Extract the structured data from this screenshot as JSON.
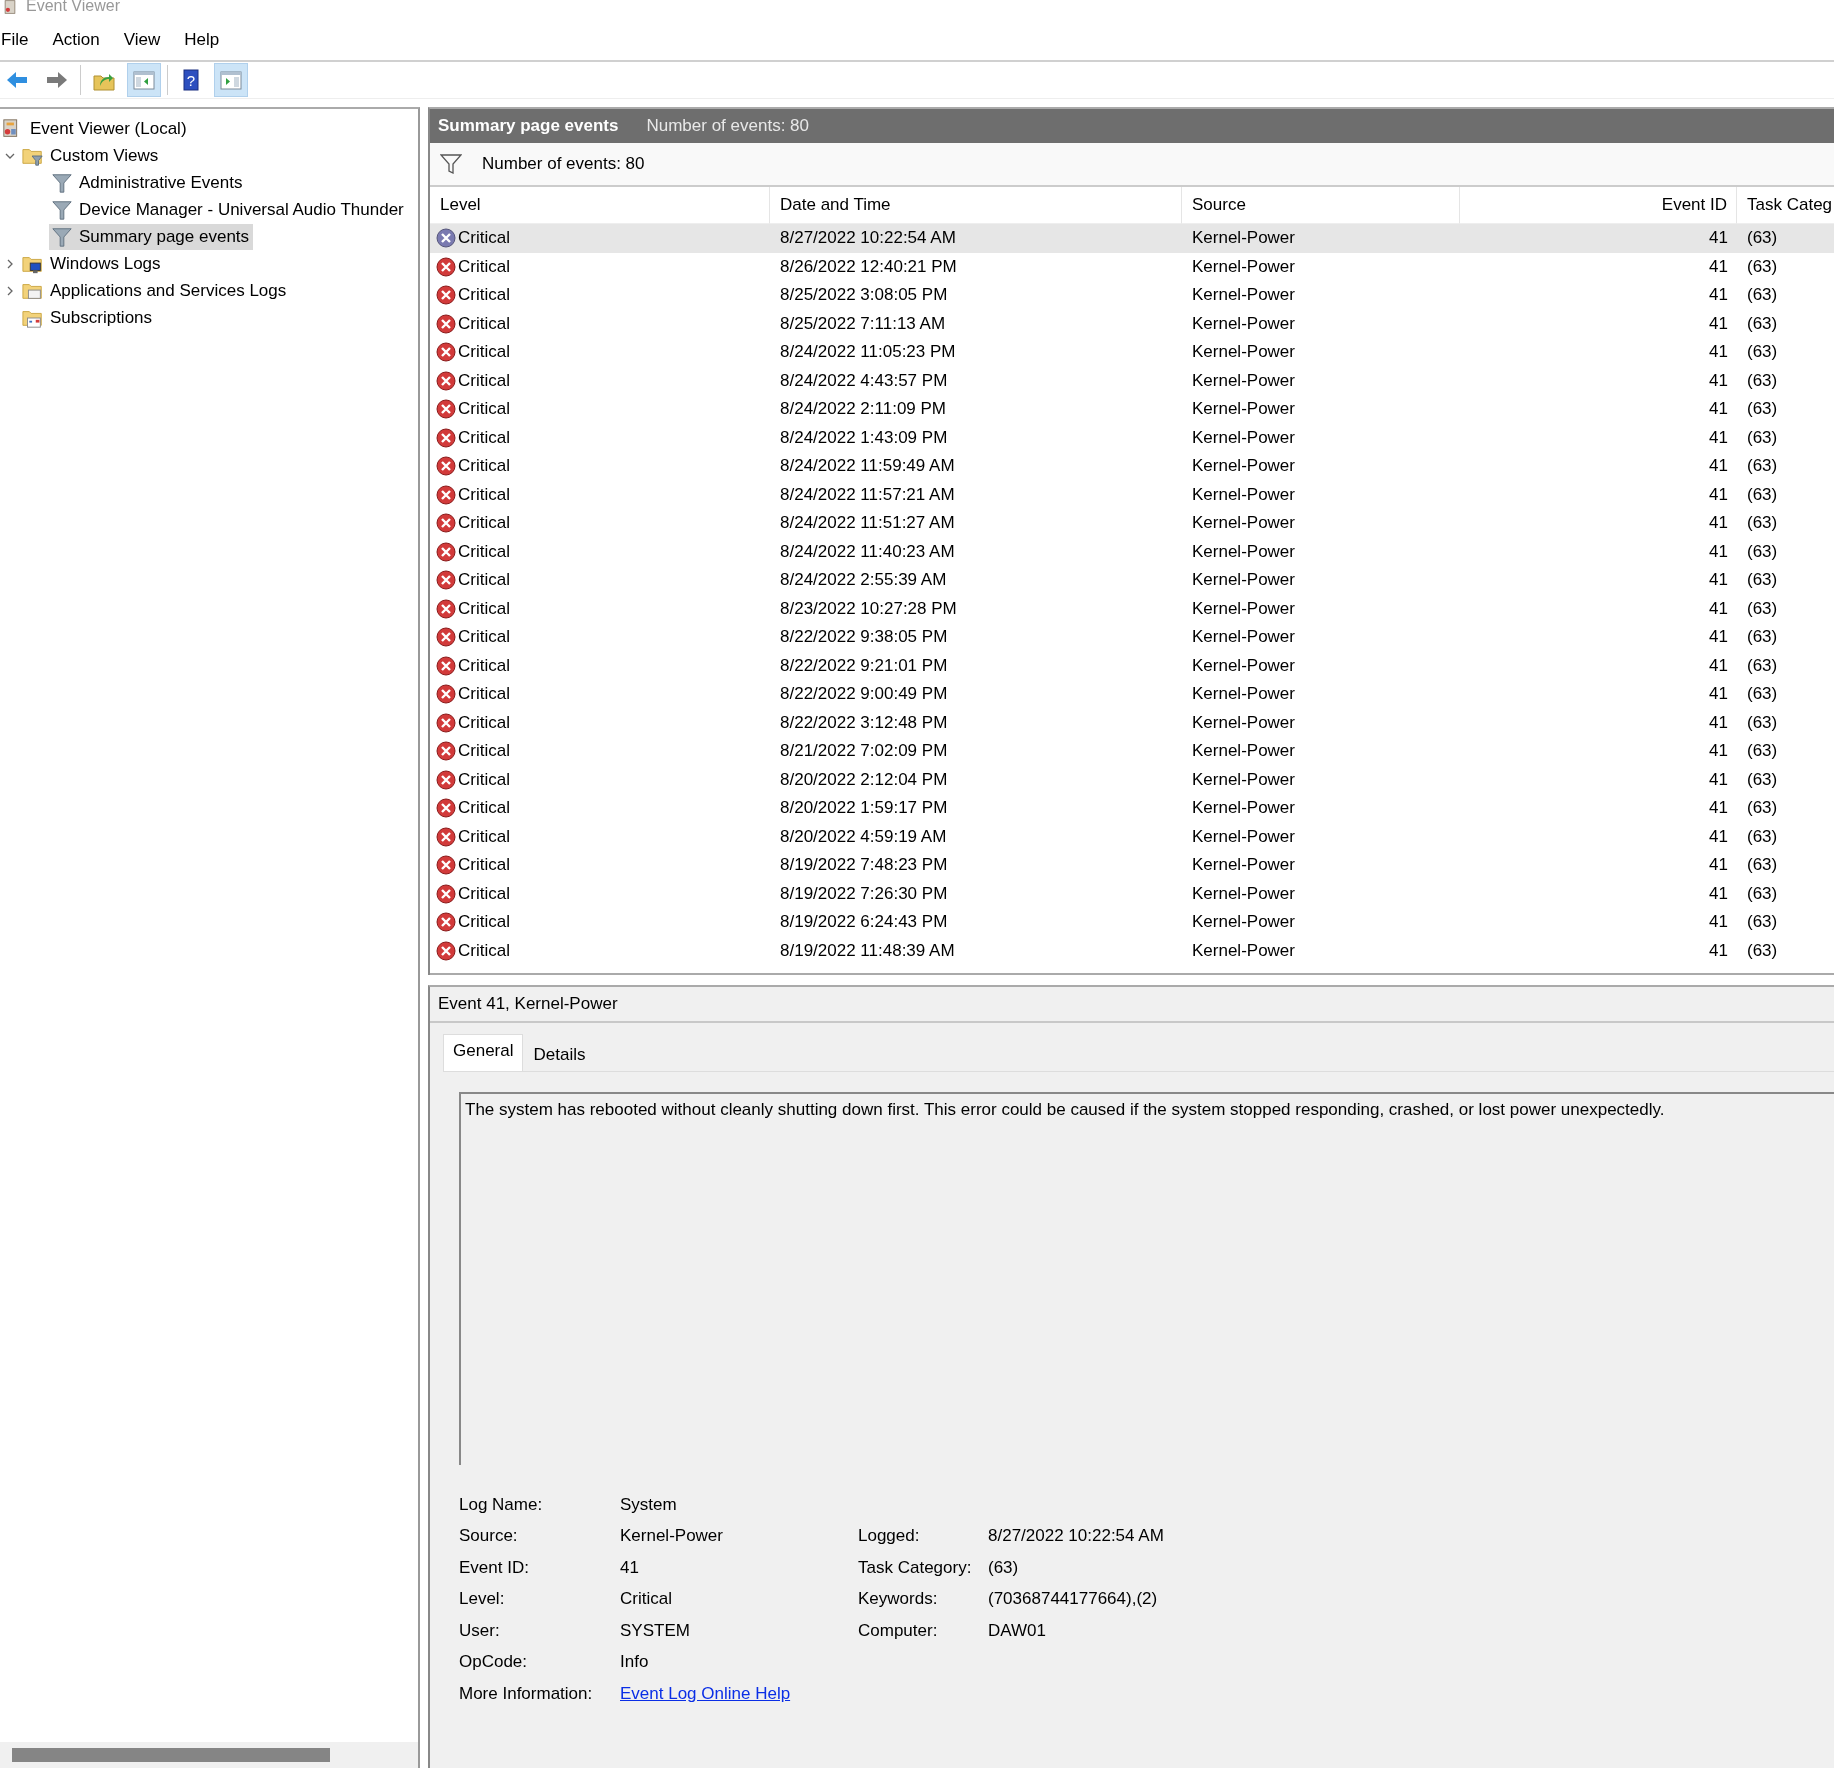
{
  "window": {
    "title": "Event Viewer"
  },
  "menu": [
    "File",
    "Action",
    "View",
    "Help"
  ],
  "toolbar": [
    {
      "kind": "back",
      "pressed": false
    },
    {
      "kind": "forward",
      "pressed": false
    },
    {
      "kind": "up",
      "pressed": false
    },
    {
      "kind": "tree",
      "pressed": true
    },
    {
      "kind": "help",
      "pressed": false,
      "glyph": "?"
    },
    {
      "kind": "actions",
      "pressed": true
    }
  ],
  "tree": [
    {
      "label": "Event Viewer (Local)",
      "kind": "computer",
      "selected": false,
      "children": [
        {
          "label": "Custom Views",
          "kind": "folder-filter",
          "selected": false,
          "expanded": true,
          "children": [
            {
              "label": "Administrative Events",
              "kind": "filter",
              "selected": false
            },
            {
              "label": "Device Manager - Universal Audio Thunder",
              "kind": "filter",
              "selected": false
            },
            {
              "label": "Summary page events",
              "kind": "filter",
              "selected": true
            }
          ]
        },
        {
          "label": "Windows Logs",
          "kind": "folder-monitor",
          "selected": false,
          "expanded": false
        },
        {
          "label": "Applications and Services Logs",
          "kind": "folder",
          "selected": false,
          "expanded": false
        },
        {
          "label": "Subscriptions",
          "kind": "folder-subscription",
          "selected": false
        }
      ]
    }
  ],
  "header": {
    "title": "Summary page events",
    "count": "Number of events: 80"
  },
  "filter_bar": {
    "text": "Number of events: 80"
  },
  "table": {
    "columns": [
      "Level",
      "Date and Time",
      "Source",
      "Event ID",
      "Task Categ"
    ],
    "rows": [
      {
        "selected": true,
        "level": "Critical",
        "date": "8/27/2022 10:22:54 AM",
        "source": "Kernel-Power",
        "event_id": "41",
        "task": "(63)"
      },
      {
        "selected": false,
        "level": "Critical",
        "date": "8/26/2022 12:40:21 PM",
        "source": "Kernel-Power",
        "event_id": "41",
        "task": "(63)"
      },
      {
        "selected": false,
        "level": "Critical",
        "date": "8/25/2022 3:08:05 PM",
        "source": "Kernel-Power",
        "event_id": "41",
        "task": "(63)"
      },
      {
        "selected": false,
        "level": "Critical",
        "date": "8/25/2022 7:11:13 AM",
        "source": "Kernel-Power",
        "event_id": "41",
        "task": "(63)"
      },
      {
        "selected": false,
        "level": "Critical",
        "date": "8/24/2022 11:05:23 PM",
        "source": "Kernel-Power",
        "event_id": "41",
        "task": "(63)"
      },
      {
        "selected": false,
        "level": "Critical",
        "date": "8/24/2022 4:43:57 PM",
        "source": "Kernel-Power",
        "event_id": "41",
        "task": "(63)"
      },
      {
        "selected": false,
        "level": "Critical",
        "date": "8/24/2022 2:11:09 PM",
        "source": "Kernel-Power",
        "event_id": "41",
        "task": "(63)"
      },
      {
        "selected": false,
        "level": "Critical",
        "date": "8/24/2022 1:43:09 PM",
        "source": "Kernel-Power",
        "event_id": "41",
        "task": "(63)"
      },
      {
        "selected": false,
        "level": "Critical",
        "date": "8/24/2022 11:59:49 AM",
        "source": "Kernel-Power",
        "event_id": "41",
        "task": "(63)"
      },
      {
        "selected": false,
        "level": "Critical",
        "date": "8/24/2022 11:57:21 AM",
        "source": "Kernel-Power",
        "event_id": "41",
        "task": "(63)"
      },
      {
        "selected": false,
        "level": "Critical",
        "date": "8/24/2022 11:51:27 AM",
        "source": "Kernel-Power",
        "event_id": "41",
        "task": "(63)"
      },
      {
        "selected": false,
        "level": "Critical",
        "date": "8/24/2022 11:40:23 AM",
        "source": "Kernel-Power",
        "event_id": "41",
        "task": "(63)"
      },
      {
        "selected": false,
        "level": "Critical",
        "date": "8/24/2022 2:55:39 AM",
        "source": "Kernel-Power",
        "event_id": "41",
        "task": "(63)"
      },
      {
        "selected": false,
        "level": "Critical",
        "date": "8/23/2022 10:27:28 PM",
        "source": "Kernel-Power",
        "event_id": "41",
        "task": "(63)"
      },
      {
        "selected": false,
        "level": "Critical",
        "date": "8/22/2022 9:38:05 PM",
        "source": "Kernel-Power",
        "event_id": "41",
        "task": "(63)"
      },
      {
        "selected": false,
        "level": "Critical",
        "date": "8/22/2022 9:21:01 PM",
        "source": "Kernel-Power",
        "event_id": "41",
        "task": "(63)"
      },
      {
        "selected": false,
        "level": "Critical",
        "date": "8/22/2022 9:00:49 PM",
        "source": "Kernel-Power",
        "event_id": "41",
        "task": "(63)"
      },
      {
        "selected": false,
        "level": "Critical",
        "date": "8/22/2022 3:12:48 PM",
        "source": "Kernel-Power",
        "event_id": "41",
        "task": "(63)"
      },
      {
        "selected": false,
        "level": "Critical",
        "date": "8/21/2022 7:02:09 PM",
        "source": "Kernel-Power",
        "event_id": "41",
        "task": "(63)"
      },
      {
        "selected": false,
        "level": "Critical",
        "date": "8/20/2022 2:12:04 PM",
        "source": "Kernel-Power",
        "event_id": "41",
        "task": "(63)"
      },
      {
        "selected": false,
        "level": "Critical",
        "date": "8/20/2022 1:59:17 PM",
        "source": "Kernel-Power",
        "event_id": "41",
        "task": "(63)"
      },
      {
        "selected": false,
        "level": "Critical",
        "date": "8/20/2022 4:59:19 AM",
        "source": "Kernel-Power",
        "event_id": "41",
        "task": "(63)"
      },
      {
        "selected": false,
        "level": "Critical",
        "date": "8/19/2022 7:48:23 PM",
        "source": "Kernel-Power",
        "event_id": "41",
        "task": "(63)"
      },
      {
        "selected": false,
        "level": "Critical",
        "date": "8/19/2022 7:26:30 PM",
        "source": "Kernel-Power",
        "event_id": "41",
        "task": "(63)"
      },
      {
        "selected": false,
        "level": "Critical",
        "date": "8/19/2022 6:24:43 PM",
        "source": "Kernel-Power",
        "event_id": "41",
        "task": "(63)"
      },
      {
        "selected": false,
        "level": "Critical",
        "date": "8/19/2022 11:48:39 AM",
        "source": "Kernel-Power",
        "event_id": "41",
        "task": "(63)"
      }
    ]
  },
  "detail": {
    "title": "Event 41, Kernel-Power",
    "tabs": [
      {
        "label": "General",
        "selected": true
      },
      {
        "label": "Details",
        "selected": false
      }
    ],
    "description": "The system has rebooted without cleanly shutting down first. This error could be caused if the system stopped responding, crashed, or lost power unexpectedly.",
    "left_fields": [
      {
        "label": "Log Name:",
        "value": "System"
      },
      {
        "label": "Source:",
        "value": "Kernel-Power"
      },
      {
        "label": "Event ID:",
        "value": "41"
      },
      {
        "label": "Level:",
        "value": "Critical"
      },
      {
        "label": "User:",
        "value": "SYSTEM"
      },
      {
        "label": "OpCode:",
        "value": "Info"
      },
      {
        "label": "More Information:",
        "value": "Event Log Online Help",
        "kind": "link"
      }
    ],
    "right_fields": [
      {
        "label": "Logged:",
        "value": "8/27/2022 10:22:54 AM"
      },
      {
        "label": "Task Category:",
        "value": "(63)"
      },
      {
        "label": "Keywords:",
        "value": "(70368744177664),(2)"
      },
      {
        "label": "Computer:",
        "value": "DAW01"
      }
    ]
  }
}
